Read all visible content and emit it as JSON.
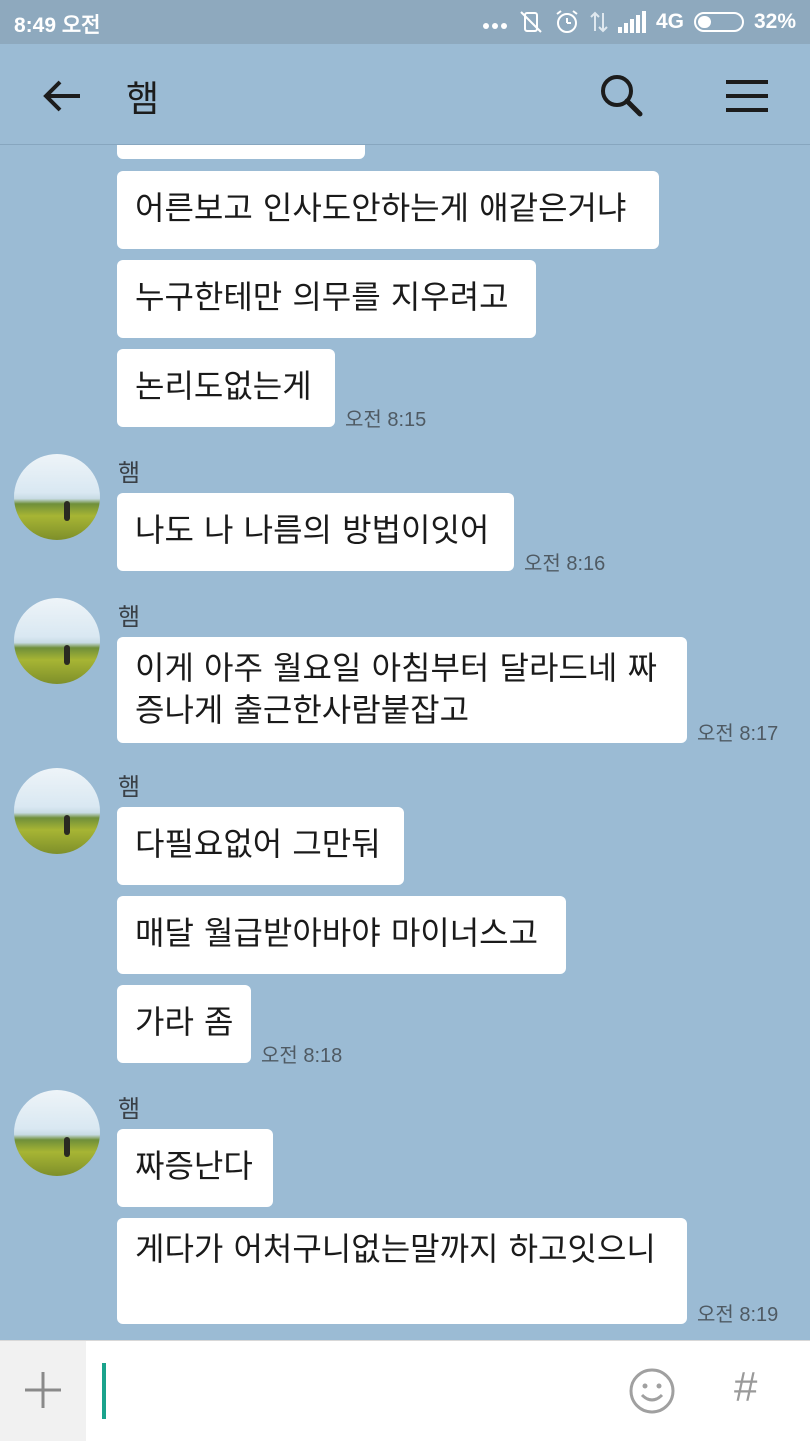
{
  "status_bar": {
    "time": "8:49 오전",
    "network": "4G",
    "battery": "32%",
    "battery_level": 0.32
  },
  "app_bar": {
    "title": "햄"
  },
  "messages": {
    "group0": {
      "bubbles": [
        "어른보고 인사도안하는게 애같은거냐",
        "누구한테만 의무를 지우려고",
        "논리도없는게"
      ],
      "time": "오전 8:15"
    },
    "group1": {
      "sender": "햄",
      "bubbles": [
        "나도 나 나름의 방법이잇어"
      ],
      "time": "오전 8:16"
    },
    "group2": {
      "sender": "햄",
      "bubbles": [
        "이게 아주 월요일 아침부터 달라드네 짜증나게 출근한사람붙잡고"
      ],
      "time": "오전 8:17"
    },
    "group3": {
      "sender": "햄",
      "bubbles": [
        "다필요없어 그만둬",
        "매달 월급받아바야 마이너스고",
        "가라 좀"
      ],
      "time": "오전 8:18"
    },
    "group4": {
      "sender": "햄",
      "bubbles": [
        "짜증난다",
        "게다가 어처구니없는말까지 하고잇으니"
      ],
      "time": "오전 8:19"
    }
  },
  "input": {
    "value": "",
    "hash_label": "#"
  },
  "colors": {
    "chat_background": "#9bbbd4",
    "bubble": "#ffffff",
    "cursor": "#1aa38c"
  }
}
